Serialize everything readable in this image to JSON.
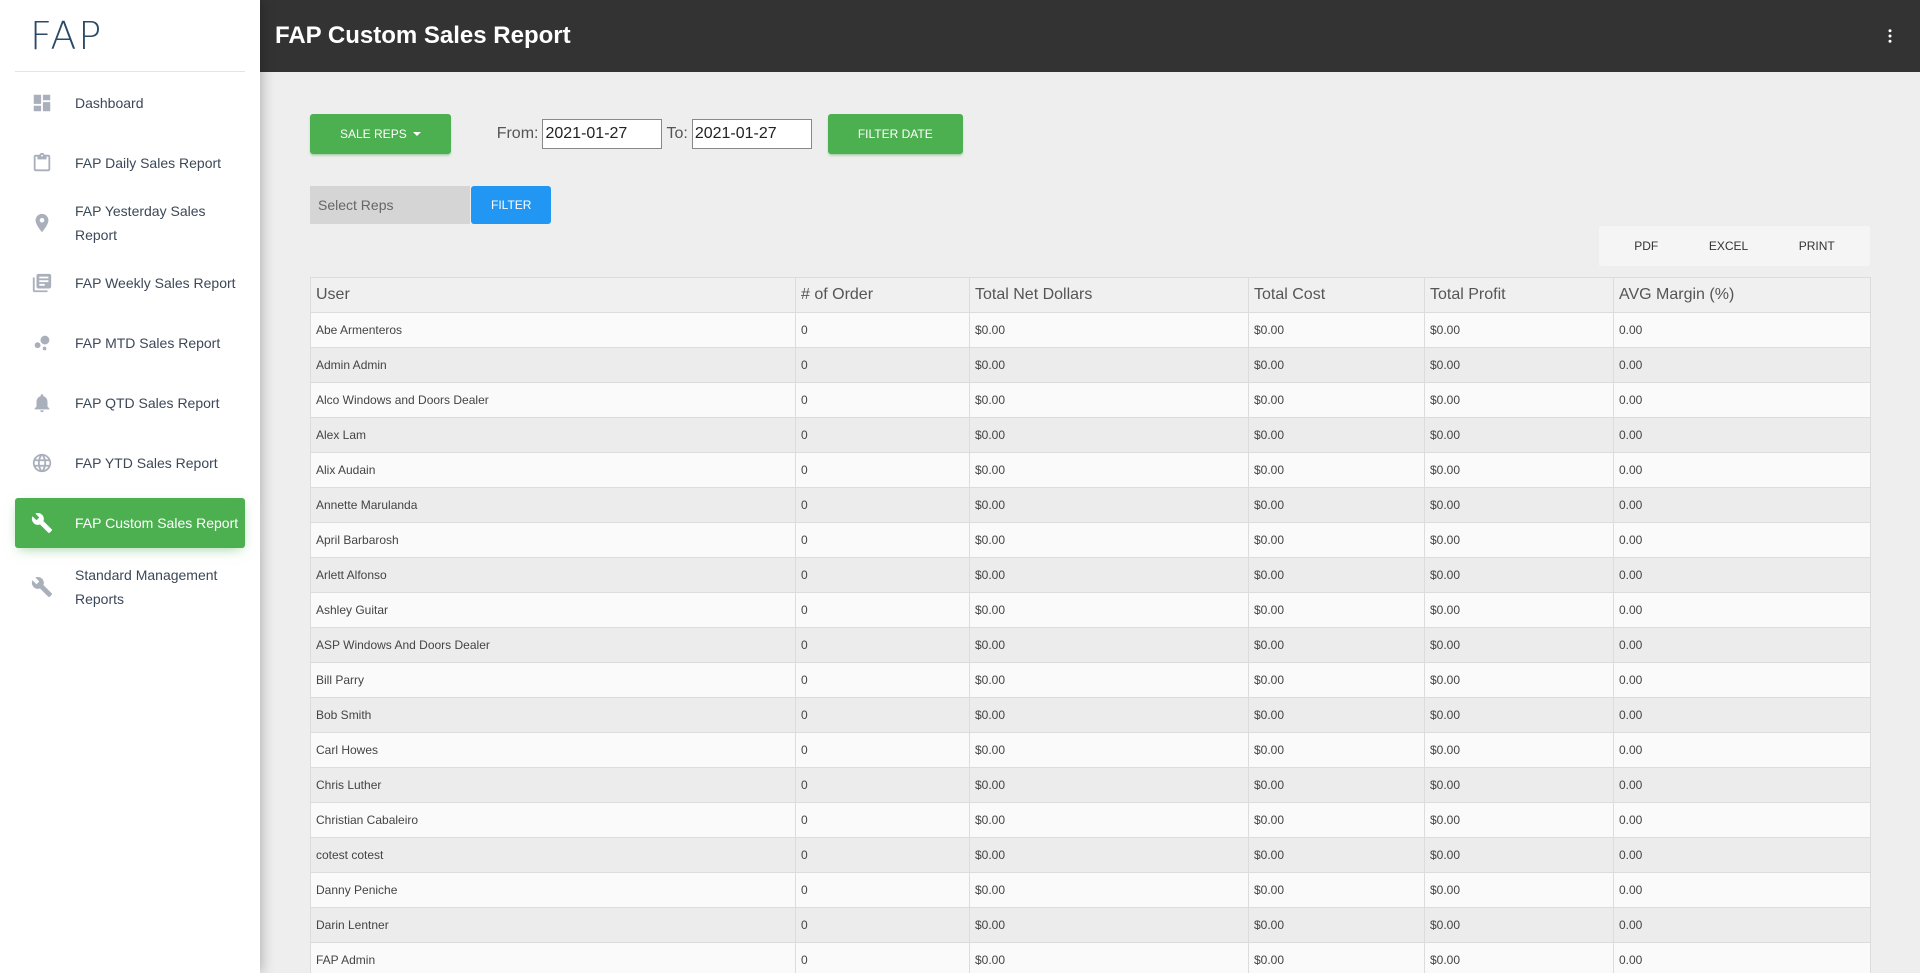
{
  "brand": {
    "logo_text": "FAP"
  },
  "header": {
    "title": "FAP Custom Sales Report"
  },
  "sidebar": {
    "items": [
      {
        "label": "Dashboard",
        "icon": "dashboard-icon"
      },
      {
        "label": "FAP Daily Sales Report",
        "icon": "clipboard-icon"
      },
      {
        "label": "FAP Yesterday Sales Report",
        "icon": "location-pin-icon"
      },
      {
        "label": "FAP Weekly Sales Report",
        "icon": "library-books-icon"
      },
      {
        "label": "FAP MTD Sales Report",
        "icon": "bubble-chart-icon"
      },
      {
        "label": "FAP QTD Sales Report",
        "icon": "bell-icon"
      },
      {
        "label": "FAP YTD Sales Report",
        "icon": "globe-icon"
      },
      {
        "label": "FAP Custom Sales Report",
        "icon": "wrench-icon",
        "active": true
      },
      {
        "label": "Standard Management Reports",
        "icon": "wrench-icon"
      }
    ]
  },
  "toolbar": {
    "sale_reps_label": "SALE REPS",
    "from_label": "From:",
    "from_value": "2021-01-27",
    "to_label": "To:",
    "to_value": "2021-01-27",
    "filter_date_label": "FILTER DATE",
    "select_reps_placeholder": "Select Reps",
    "filter_label": "FILTER"
  },
  "export": {
    "pdf": "PDF",
    "excel": "EXCEL",
    "print": "PRINT"
  },
  "table": {
    "columns": [
      "User",
      "# of Order",
      "Total Net Dollars",
      "Total Cost",
      "Total Profit",
      "AVG Margin (%)"
    ],
    "rows": [
      [
        "Abe Armenteros",
        "0",
        "$0.00",
        "$0.00",
        "$0.00",
        "0.00"
      ],
      [
        "Admin Admin",
        "0",
        "$0.00",
        "$0.00",
        "$0.00",
        "0.00"
      ],
      [
        "Alco Windows and Doors Dealer",
        "0",
        "$0.00",
        "$0.00",
        "$0.00",
        "0.00"
      ],
      [
        "Alex Lam",
        "0",
        "$0.00",
        "$0.00",
        "$0.00",
        "0.00"
      ],
      [
        "Alix Audain",
        "0",
        "$0.00",
        "$0.00",
        "$0.00",
        "0.00"
      ],
      [
        "Annette Marulanda",
        "0",
        "$0.00",
        "$0.00",
        "$0.00",
        "0.00"
      ],
      [
        "April Barbarosh",
        "0",
        "$0.00",
        "$0.00",
        "$0.00",
        "0.00"
      ],
      [
        "Arlett Alfonso",
        "0",
        "$0.00",
        "$0.00",
        "$0.00",
        "0.00"
      ],
      [
        "Ashley Guitar",
        "0",
        "$0.00",
        "$0.00",
        "$0.00",
        "0.00"
      ],
      [
        "ASP Windows And Doors Dealer",
        "0",
        "$0.00",
        "$0.00",
        "$0.00",
        "0.00"
      ],
      [
        "Bill Parry",
        "0",
        "$0.00",
        "$0.00",
        "$0.00",
        "0.00"
      ],
      [
        "Bob Smith",
        "0",
        "$0.00",
        "$0.00",
        "$0.00",
        "0.00"
      ],
      [
        "Carl Howes",
        "0",
        "$0.00",
        "$0.00",
        "$0.00",
        "0.00"
      ],
      [
        "Chris Luther",
        "0",
        "$0.00",
        "$0.00",
        "$0.00",
        "0.00"
      ],
      [
        "Christian Cabaleiro",
        "0",
        "$0.00",
        "$0.00",
        "$0.00",
        "0.00"
      ],
      [
        "cotest cotest",
        "0",
        "$0.00",
        "$0.00",
        "$0.00",
        "0.00"
      ],
      [
        "Danny Peniche",
        "0",
        "$0.00",
        "$0.00",
        "$0.00",
        "0.00"
      ],
      [
        "Darin Lentner",
        "0",
        "$0.00",
        "$0.00",
        "$0.00",
        "0.00"
      ],
      [
        "FAP Admin",
        "0",
        "$0.00",
        "$0.00",
        "$0.00",
        "0.00"
      ]
    ]
  },
  "colors": {
    "accent_green": "#4caf50",
    "accent_blue": "#2196f3",
    "header_bg": "#333333"
  }
}
